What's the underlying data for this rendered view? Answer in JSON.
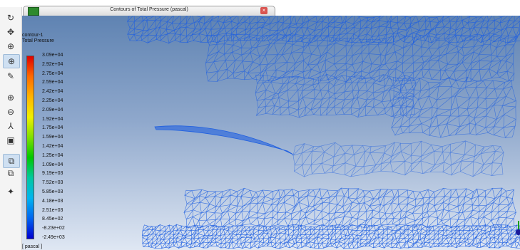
{
  "window": {
    "tab_title": "Contours of Total Pressure (pascal)",
    "close_glyph": "×"
  },
  "toolbar": [
    {
      "id": "rotate",
      "icon": "rotate-icon",
      "glyph": "↻",
      "active": false
    },
    {
      "id": "pan",
      "icon": "pan-icon",
      "glyph": "✥",
      "active": false
    },
    {
      "id": "zoom",
      "icon": "zoom-icon",
      "glyph": "⊕",
      "active": false
    },
    {
      "id": "zoom-to-area",
      "icon": "zoom-to-area-icon",
      "glyph": "⊕",
      "active": true
    },
    {
      "id": "probe",
      "icon": "probe-icon",
      "glyph": "✎",
      "active": false
    },
    {
      "id": "zoom-in",
      "icon": "zoom-in-icon",
      "glyph": "⊕",
      "active": false
    },
    {
      "id": "zoom-out",
      "icon": "zoom-out-icon",
      "glyph": "⊖",
      "active": false
    },
    {
      "id": "axes",
      "icon": "axes-icon",
      "glyph": "⅄",
      "active": false
    },
    {
      "id": "fit",
      "icon": "fit-to-window-icon",
      "glyph": "▣",
      "active": false
    },
    {
      "id": "view",
      "icon": "view-icon",
      "glyph": "⧉",
      "active": true
    },
    {
      "id": "view-options",
      "icon": "view-options-icon",
      "glyph": "⧉",
      "active": false
    },
    {
      "id": "lights",
      "icon": "lights-icon",
      "glyph": "✦",
      "active": false
    }
  ],
  "legend": {
    "title_line1": "contour-1",
    "title_line2": "Total Pressure",
    "unit": "[ pascal ]",
    "levels": [
      "3.09e+04",
      "2.92e+04",
      "2.75e+04",
      "2.59e+04",
      "2.42e+04",
      "2.25e+04",
      "2.09e+04",
      "1.92e+04",
      "1.75e+04",
      "1.59e+04",
      "1.42e+04",
      "1.25e+04",
      "1.09e+04",
      "9.19e+03",
      "7.52e+03",
      "5.85e+03",
      "4.18e+03",
      "2.51e+03",
      "8.45e+02",
      "-8.23e+02",
      "-2.49e+03"
    ]
  },
  "colors": {
    "mesh": "#1f5fe0",
    "background_top": "#5f83b2",
    "background_bottom": "#dfe7f3"
  }
}
